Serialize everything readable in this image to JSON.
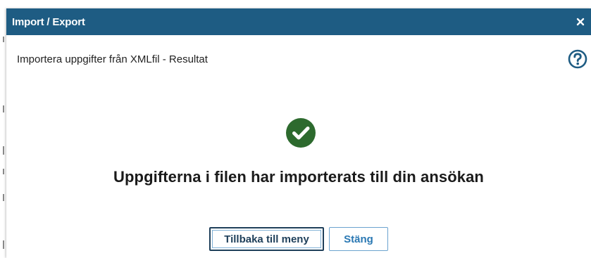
{
  "dialog": {
    "title": "Import / Export",
    "close_symbol": "×",
    "subheader": "Importera uppgifter från XMLfil - Resultat",
    "help_icon": "question-circle-icon",
    "status_icon": "check-circle-icon",
    "result_message": "Uppgifterna i filen har importerats till din ansökan",
    "buttons": {
      "back_label": "Tillbaka till meny",
      "close_label": "Stäng"
    }
  },
  "colors": {
    "titlebar": "#1e5c83",
    "success": "#2d6a2e",
    "help": "#1e5c83",
    "button_primary_border": "#1e3f5a",
    "button_secondary_text": "#2a78b3"
  }
}
